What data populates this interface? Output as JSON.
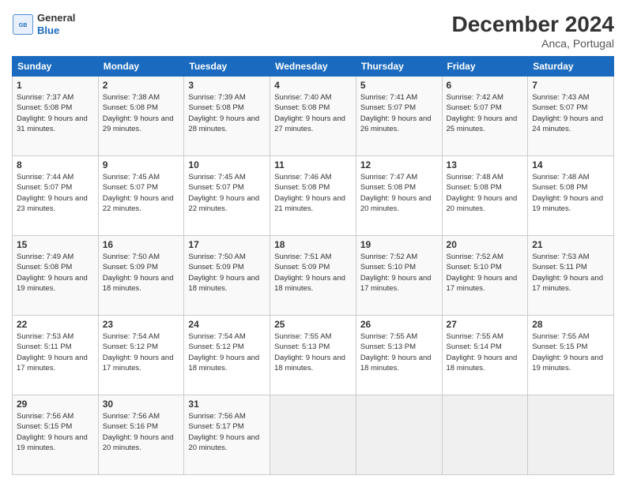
{
  "app": {
    "logo_general": "General",
    "logo_blue": "Blue",
    "title": "December 2024",
    "subtitle": "Anca, Portugal"
  },
  "calendar": {
    "headers": [
      "Sunday",
      "Monday",
      "Tuesday",
      "Wednesday",
      "Thursday",
      "Friday",
      "Saturday"
    ],
    "rows": [
      [
        {
          "day": "1",
          "sunrise": "7:37 AM",
          "sunset": "5:08 PM",
          "daylight": "9 hours and 31 minutes."
        },
        {
          "day": "2",
          "sunrise": "7:38 AM",
          "sunset": "5:08 PM",
          "daylight": "9 hours and 29 minutes."
        },
        {
          "day": "3",
          "sunrise": "7:39 AM",
          "sunset": "5:08 PM",
          "daylight": "9 hours and 28 minutes."
        },
        {
          "day": "4",
          "sunrise": "7:40 AM",
          "sunset": "5:08 PM",
          "daylight": "9 hours and 27 minutes."
        },
        {
          "day": "5",
          "sunrise": "7:41 AM",
          "sunset": "5:07 PM",
          "daylight": "9 hours and 26 minutes."
        },
        {
          "day": "6",
          "sunrise": "7:42 AM",
          "sunset": "5:07 PM",
          "daylight": "9 hours and 25 minutes."
        },
        {
          "day": "7",
          "sunrise": "7:43 AM",
          "sunset": "5:07 PM",
          "daylight": "9 hours and 24 minutes."
        }
      ],
      [
        {
          "day": "8",
          "sunrise": "7:44 AM",
          "sunset": "5:07 PM",
          "daylight": "9 hours and 23 minutes."
        },
        {
          "day": "9",
          "sunrise": "7:45 AM",
          "sunset": "5:07 PM",
          "daylight": "9 hours and 22 minutes."
        },
        {
          "day": "10",
          "sunrise": "7:45 AM",
          "sunset": "5:07 PM",
          "daylight": "9 hours and 22 minutes."
        },
        {
          "day": "11",
          "sunrise": "7:46 AM",
          "sunset": "5:08 PM",
          "daylight": "9 hours and 21 minutes."
        },
        {
          "day": "12",
          "sunrise": "7:47 AM",
          "sunset": "5:08 PM",
          "daylight": "9 hours and 20 minutes."
        },
        {
          "day": "13",
          "sunrise": "7:48 AM",
          "sunset": "5:08 PM",
          "daylight": "9 hours and 20 minutes."
        },
        {
          "day": "14",
          "sunrise": "7:48 AM",
          "sunset": "5:08 PM",
          "daylight": "9 hours and 19 minutes."
        }
      ],
      [
        {
          "day": "15",
          "sunrise": "7:49 AM",
          "sunset": "5:08 PM",
          "daylight": "9 hours and 19 minutes."
        },
        {
          "day": "16",
          "sunrise": "7:50 AM",
          "sunset": "5:09 PM",
          "daylight": "9 hours and 18 minutes."
        },
        {
          "day": "17",
          "sunrise": "7:50 AM",
          "sunset": "5:09 PM",
          "daylight": "9 hours and 18 minutes."
        },
        {
          "day": "18",
          "sunrise": "7:51 AM",
          "sunset": "5:09 PM",
          "daylight": "9 hours and 18 minutes."
        },
        {
          "day": "19",
          "sunrise": "7:52 AM",
          "sunset": "5:10 PM",
          "daylight": "9 hours and 17 minutes."
        },
        {
          "day": "20",
          "sunrise": "7:52 AM",
          "sunset": "5:10 PM",
          "daylight": "9 hours and 17 minutes."
        },
        {
          "day": "21",
          "sunrise": "7:53 AM",
          "sunset": "5:11 PM",
          "daylight": "9 hours and 17 minutes."
        }
      ],
      [
        {
          "day": "22",
          "sunrise": "7:53 AM",
          "sunset": "5:11 PM",
          "daylight": "9 hours and 17 minutes."
        },
        {
          "day": "23",
          "sunrise": "7:54 AM",
          "sunset": "5:12 PM",
          "daylight": "9 hours and 17 minutes."
        },
        {
          "day": "24",
          "sunrise": "7:54 AM",
          "sunset": "5:12 PM",
          "daylight": "9 hours and 18 minutes."
        },
        {
          "day": "25",
          "sunrise": "7:55 AM",
          "sunset": "5:13 PM",
          "daylight": "9 hours and 18 minutes."
        },
        {
          "day": "26",
          "sunrise": "7:55 AM",
          "sunset": "5:13 PM",
          "daylight": "9 hours and 18 minutes."
        },
        {
          "day": "27",
          "sunrise": "7:55 AM",
          "sunset": "5:14 PM",
          "daylight": "9 hours and 18 minutes."
        },
        {
          "day": "28",
          "sunrise": "7:55 AM",
          "sunset": "5:15 PM",
          "daylight": "9 hours and 19 minutes."
        }
      ],
      [
        {
          "day": "29",
          "sunrise": "7:56 AM",
          "sunset": "5:15 PM",
          "daylight": "9 hours and 19 minutes."
        },
        {
          "day": "30",
          "sunrise": "7:56 AM",
          "sunset": "5:16 PM",
          "daylight": "9 hours and 20 minutes."
        },
        {
          "day": "31",
          "sunrise": "7:56 AM",
          "sunset": "5:17 PM",
          "daylight": "9 hours and 20 minutes."
        },
        null,
        null,
        null,
        null
      ]
    ],
    "labels": {
      "sunrise": "Sunrise:",
      "sunset": "Sunset:",
      "daylight": "Daylight:"
    }
  }
}
